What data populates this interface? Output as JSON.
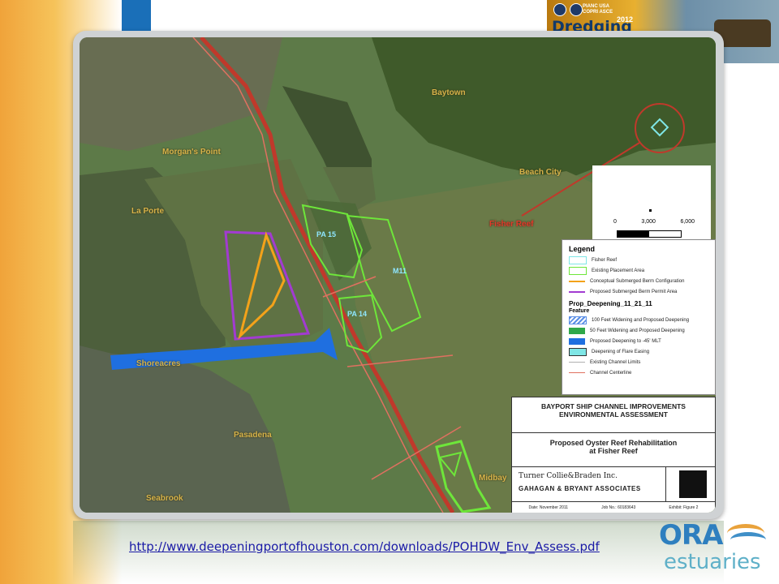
{
  "banner": {
    "sponsor_lines": "PIANC USA\nCOPRI ASCE",
    "brand": "Dredging",
    "year": "2012"
  },
  "map": {
    "places": [
      "Baytown",
      "Morgan's Point",
      "La Porte",
      "Beach City",
      "Shoreacres",
      "Pasadena",
      "Seabrook",
      "Midbay"
    ],
    "sites": [
      "PA 15",
      "M11",
      "PA 14"
    ],
    "fisher_reef_label": "Fisher Reef",
    "scale_ticks": [
      "0",
      "3,000",
      "6,000"
    ],
    "colors": {
      "channel": "#c0392b",
      "placement_area": "#6ee63a",
      "berm": "#f3a21a",
      "permit_area": "#a23bd1",
      "deepening": "#1f6fe0",
      "fisher_reef": "#7fe6e6"
    }
  },
  "legend": {
    "title": "Legend",
    "items": [
      {
        "label": "Fisher Reef",
        "color": "#7fe6e6",
        "kind": "outline"
      },
      {
        "label": "Existing Placement Area",
        "color": "#6ee63a",
        "kind": "outline"
      },
      {
        "label": "Conceptual Submerged Berm Configuration",
        "color": "#f3a21a",
        "kind": "line"
      },
      {
        "label": "Proposed Submerged Berm Permit Area",
        "color": "#a23bd1",
        "kind": "line"
      }
    ],
    "section_title": "Prop_Deepening_11_21_11",
    "feature_label": "Feature",
    "features": [
      {
        "label": "100 Feet Widening and Proposed Deepening",
        "color": "#5b8fe6",
        "kind": "hatch"
      },
      {
        "label": "50 Feet Widening and Proposed Deepening",
        "color": "#2fa84a",
        "kind": "fill"
      },
      {
        "label": "Proposed Deepening to -45' MLT",
        "color": "#1f6fe0",
        "kind": "fill"
      },
      {
        "label": "Deepening of Flare Easing",
        "color": "#7fe6e6",
        "kind": "fill"
      },
      {
        "label": "Existing Channel Limits",
        "color": "#b0b0b0",
        "kind": "line"
      },
      {
        "label": "Channel Centerline",
        "color": "#e07060",
        "kind": "line"
      }
    ]
  },
  "titleblock": {
    "project_line1": "BAYPORT SHIP CHANNEL IMPROVEMENTS",
    "project_line2": "ENVIRONMENTAL ASSESSMENT",
    "drawing_line1": "Proposed Oyster Reef Rehabilitation",
    "drawing_line2": "at Fisher Reef",
    "firm1": "Turner Collie&Braden Inc.",
    "firm2": "GAHAGAN & BRYANT ASSOCIATES",
    "date_label": "Date:",
    "date_value": "November 2011",
    "job_label": "Job No.:",
    "job_value": "60183643",
    "exhibit_label": "Exhibit:",
    "exhibit_value": "Figure 2"
  },
  "footer": {
    "url": "http://www.deepeningportofhouston.com/downloads/POHDW_Env_Assess.pdf",
    "logo_top": "ORA",
    "logo_bottom": "estuaries"
  }
}
